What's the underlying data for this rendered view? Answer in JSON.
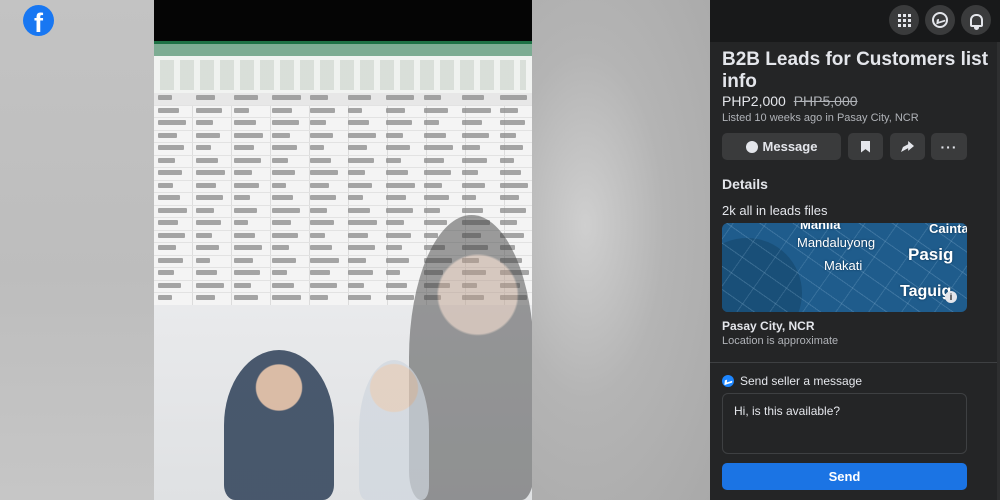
{
  "brand": {
    "logo_letter": "f"
  },
  "topbar": {
    "icons": [
      "menu-grid-icon",
      "messenger-icon",
      "notifications-bell-icon"
    ]
  },
  "listing": {
    "title": "B2B Leads for Customers list info",
    "price": "PHP2,000",
    "original_price": "PHP5,000",
    "listed": "Listed 10 weeks ago in Pasay City, NCR"
  },
  "actions": {
    "message_label": "Message",
    "more_label": "···"
  },
  "details": {
    "heading": "Details",
    "text": "2k all in leads files"
  },
  "map": {
    "labels": {
      "manila": "Manila",
      "mandaluyong": "Mandaluyong",
      "cainta": "Cainta",
      "makati": "Makati",
      "pasig": "Pasig",
      "taguig": "Taguig"
    },
    "info": "i"
  },
  "location": {
    "name": "Pasay City, NCR",
    "note": "Location is approximate"
  },
  "seller_message": {
    "heading": "Send seller a message",
    "input_value": "Hi, is this available?",
    "send_label": "Send"
  },
  "colors": {
    "facebook_blue": "#1877f2",
    "send_button": "#1b74e4",
    "panel_bg": "#242526",
    "map_water": "#1f5c8c"
  }
}
